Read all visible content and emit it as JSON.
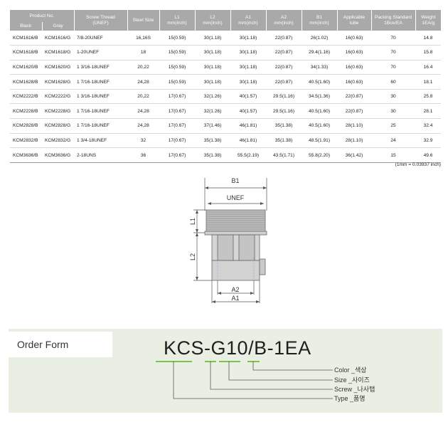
{
  "table": {
    "headers": {
      "product_no": "Product No.",
      "black": "Black",
      "gray": "Gray",
      "screw_thread_1": "Screw Thread",
      "screw_thread_2": "(UNEF)",
      "steel_size": "Steel Size",
      "l1": "L1",
      "l2": "L2",
      "a1": "A1",
      "a2": "A2",
      "b1": "B1",
      "unit": "mm(inch)",
      "applicable_1": "Applicable",
      "applicable_2": "tube",
      "packing_1": "Packing Standard",
      "packing_2": "1Box/EA",
      "weight_1": "Weight",
      "weight_2": "1EA/g"
    },
    "rows": [
      [
        "KCM1616/B",
        "KCM1616/G",
        "7/8-20UNEF",
        "16,16S",
        "15(0.59)",
        "30(1.18)",
        "30(1.18)",
        "22(0.87)",
        "26(1.02)",
        "16(0.63)",
        "70",
        "14.8"
      ],
      [
        "KCM1618/B",
        "KCM1618/G",
        "1-20UNEF",
        "18",
        "15(0.59)",
        "30(1.18)",
        "30(1.18)",
        "22(0.87)",
        "29.4(1.16)",
        "16(0.63)",
        "70",
        "15.8"
      ],
      [
        "KCM1620/B",
        "KCM1620/G",
        "1 3/16-18UNEF",
        "20,22",
        "15(0.59)",
        "30(1.18)",
        "30(1.18)",
        "22(0.87)",
        "34(1.33)",
        "16(0.63)",
        "70",
        "16.4"
      ],
      [
        "KCM1628/B",
        "KCM1628/G",
        "1 7/16-18UNEF",
        "24,28",
        "15(0.59)",
        "30(1.18)",
        "30(1.18)",
        "22(0.87)",
        "40.5(1.60)",
        "16(0.63)",
        "60",
        "18.1"
      ],
      [
        "KCM2222/B",
        "KCM2222/G",
        "1 3/16-18UNEF",
        "20,22",
        "17(0.67)",
        "32(1.26)",
        "40(1.57)",
        "29.5(1.16)",
        "34.5(1.36)",
        "22(0.87)",
        "30",
        "25.8"
      ],
      [
        "KCM2228/B",
        "KCM2228/G",
        "1 7/16-18UNEF",
        "24,28",
        "17(0.67)",
        "32(1.26)",
        "40(1.57)",
        "29.5(1.16)",
        "40.5(1.60)",
        "22(0.87)",
        "30",
        "28.1"
      ],
      [
        "KCM2828/B",
        "KCM2828/G",
        "1 7/16-18UNEF",
        "24,28",
        "17(0.67)",
        "37(1.46)",
        "46(1.81)",
        "35(1.38)",
        "40.5(1.60)",
        "28(1.10)",
        "25",
        "32.4"
      ],
      [
        "KCM2832/B",
        "KCM2832/G",
        "1 3/4-18UNEF",
        "32",
        "17(0.67)",
        "35(1.38)",
        "46(1.81)",
        "35(1.38)",
        "48.5(1.91)",
        "28(1.10)",
        "24",
        "32.9"
      ],
      [
        "KCM3636/B",
        "KCM3636/G",
        "2-18UNS",
        "36",
        "17(0.67)",
        "35(1.38)",
        "55.5(2.19)",
        "43.5(1.71)",
        "55.8(2.20)",
        "36(1.42)",
        "15",
        "49.6"
      ]
    ]
  },
  "conversion_note": "(1mm = 0.03937 inch)",
  "drawing": {
    "labels": {
      "b1": "B1",
      "unef": "UNEF",
      "l1": "L1",
      "l2": "L2",
      "a2": "A2",
      "a1": "A1"
    }
  },
  "order_form": {
    "title": "Order Form",
    "code_parts": {
      "kcs": "KCS-",
      "g": "G",
      "size": "10",
      "slash": "/",
      "color": "B",
      "qty": "-1EA"
    },
    "legend": [
      {
        "label": "Color _색상"
      },
      {
        "label": "Size _사이즈"
      },
      {
        "label": "Screw _나사탭"
      },
      {
        "label": "Type _품명"
      }
    ],
    "accent_color": "#7dc24b",
    "panel_color": "#e9f0e3"
  }
}
